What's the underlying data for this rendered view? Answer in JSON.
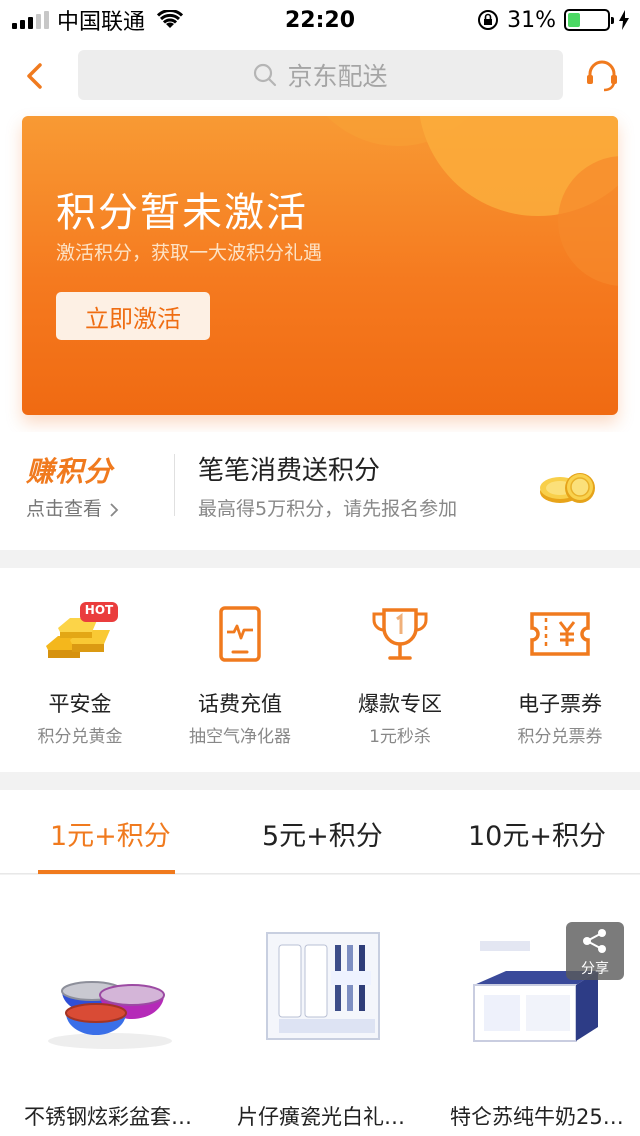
{
  "status_bar": {
    "carrier": "中国联通",
    "time": "22:20",
    "battery": "31%",
    "battery_level": 0.31
  },
  "navbar": {
    "search_placeholder": "京东配送",
    "icons": [
      "back-icon",
      "search-icon",
      "customer-service-icon"
    ]
  },
  "banner": {
    "title": "积分暂未激活",
    "subtitle": "激活积分，获取一大波积分礼遇",
    "button_label": "立即激活"
  },
  "earn": {
    "logo_text": "赚积分",
    "link_text": "点击查看",
    "title": "笔笔消费送积分",
    "description": "最高得5万积分，请先报名参加"
  },
  "categories": [
    {
      "name": "平安金",
      "desc": "积分兑黄金",
      "icon": "gold-bars-icon",
      "badge": "HOT"
    },
    {
      "name": "话费充值",
      "desc": "抽空气净化器",
      "icon": "phone-recharge-icon"
    },
    {
      "name": "爆款专区",
      "desc": "1元秒杀",
      "icon": "trophy-icon"
    },
    {
      "name": "电子票券",
      "desc": "积分兑票券",
      "icon": "ticket-icon"
    }
  ],
  "tabs": [
    {
      "label": "1元+积分",
      "active": true
    },
    {
      "label": "5元+积分",
      "active": false
    },
    {
      "label": "10元+积分",
      "active": false
    }
  ],
  "products": [
    {
      "name": "不锈钢炫彩盆套…",
      "icon": "bowls-image"
    },
    {
      "name": "片仔癀瓷光白礼…",
      "icon": "toothpaste-gift-image"
    },
    {
      "name": "特仑苏纯牛奶250…",
      "icon": "milk-box-image"
    }
  ],
  "share": {
    "label": "分享"
  },
  "colors": {
    "accent": "#f07a1e",
    "banner": "#f57a1f"
  }
}
